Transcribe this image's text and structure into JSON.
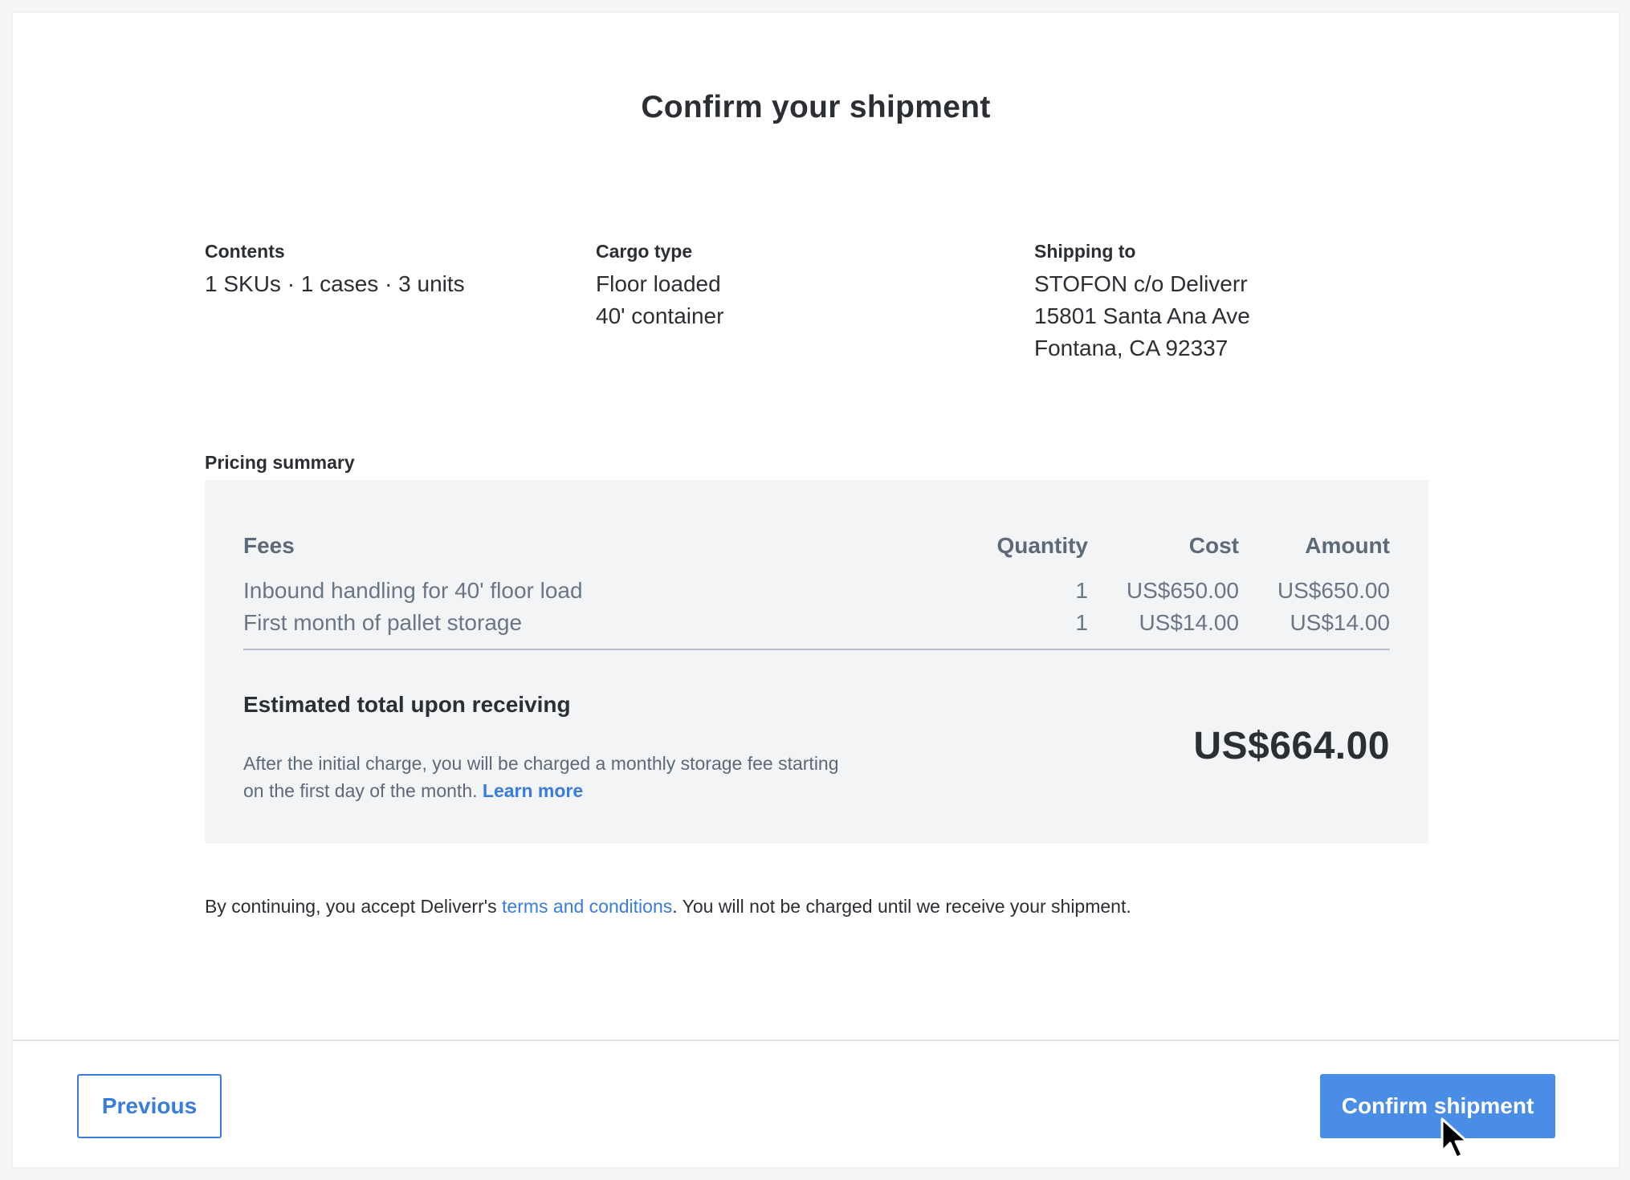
{
  "header": {
    "title": "Confirm your shipment"
  },
  "summary": {
    "contents": {
      "label": "Contents",
      "lines": [
        "1 SKUs · 1 cases · 3 units"
      ]
    },
    "cargo": {
      "label": "Cargo type",
      "lines": [
        "Floor loaded",
        "40' container"
      ]
    },
    "shipping_to": {
      "label": "Shipping to",
      "lines": [
        "STOFON c/o Deliverr",
        "15801 Santa Ana Ave",
        "Fontana, CA 92337"
      ]
    }
  },
  "pricing": {
    "label": "Pricing summary",
    "columns": {
      "fees": "Fees",
      "quantity": "Quantity",
      "cost": "Cost",
      "amount": "Amount"
    },
    "rows": [
      {
        "fee": "Inbound handling for 40' floor load",
        "quantity": "1",
        "cost": "US$650.00",
        "amount": "US$650.00"
      },
      {
        "fee": "First month of pallet storage",
        "quantity": "1",
        "cost": "US$14.00",
        "amount": "US$14.00"
      }
    ],
    "total_label": "Estimated total upon receiving",
    "total_amount": "US$664.00",
    "note_text": "After the initial charge, you will be charged a monthly storage fee starting on the first day of the month.",
    "learn_more": "Learn more"
  },
  "terms": {
    "prefix": "By continuing, you accept Deliverr's",
    "link": "terms and conditions",
    "suffix": ". You will not be charged until we receive your shipment."
  },
  "footer": {
    "previous_label": "Previous",
    "confirm_label": "Confirm shipment"
  },
  "colors": {
    "accent": "#3a7be0",
    "primary_button": "#4a8de6",
    "panel_background": "#f3f4f6"
  },
  "icons": {
    "cursor": "mouse-pointer-icon"
  }
}
